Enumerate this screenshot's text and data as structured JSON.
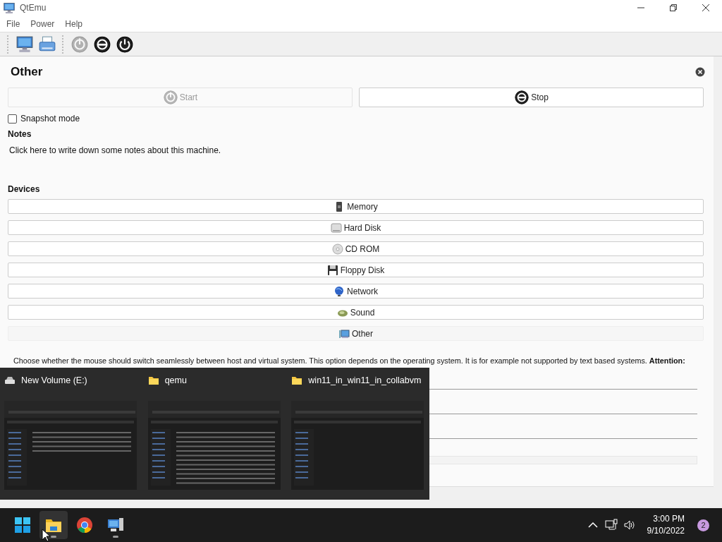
{
  "window": {
    "title": "QtEmu"
  },
  "menu": [
    "File",
    "Power",
    "Help"
  ],
  "toolbar": [
    {
      "kind": "computer",
      "disabled": false
    },
    {
      "kind": "printer",
      "disabled": false
    },
    {
      "kind": "power",
      "disabled": true
    },
    {
      "kind": "stop",
      "disabled": false
    },
    {
      "kind": "restart",
      "disabled": false
    }
  ],
  "machine": {
    "name": "Other",
    "start_button": {
      "label": "Start",
      "disabled": true
    },
    "stop_button": {
      "label": "Stop",
      "disabled": false
    },
    "snapshot_mode": {
      "label": "Snapshot mode",
      "checked": false
    },
    "notes": {
      "heading": "Notes",
      "text": "Click here to write down some notes about this machine."
    },
    "devices": {
      "heading": "Devices",
      "items": [
        {
          "label": "Memory",
          "kind": "memory",
          "expanded": false
        },
        {
          "label": "Hard Disk",
          "kind": "harddisk",
          "expanded": false
        },
        {
          "label": "CD ROM",
          "kind": "cdrom",
          "expanded": false
        },
        {
          "label": "Floppy Disk",
          "kind": "floppy",
          "expanded": false
        },
        {
          "label": "Network",
          "kind": "network",
          "expanded": false
        },
        {
          "label": "Sound",
          "kind": "sound",
          "expanded": false
        },
        {
          "label": "Other",
          "kind": "other",
          "expanded": true
        }
      ]
    },
    "other_help": "Choose whether the mouse should switch seamlessly between host and virtual system. This option depends on the operating system. It is for example not supported by text based systems. **Attention:**"
  },
  "taskbar_previews": [
    {
      "title": "New Volume (E:)",
      "kind": "drive"
    },
    {
      "title": "qemu",
      "kind": "folder"
    },
    {
      "title": "win11_in_win11_in_collabvm",
      "kind": "folder"
    }
  ],
  "taskbar": {
    "apps": [
      {
        "kind": "start",
        "running": false,
        "selected": false
      },
      {
        "kind": "explorer",
        "running": true,
        "selected": true
      },
      {
        "kind": "browser",
        "running": false,
        "selected": false
      },
      {
        "kind": "computer",
        "running": true,
        "selected": false
      }
    ],
    "time": "3:00 PM",
    "date": "9/10/2022",
    "notification_count": "2"
  }
}
